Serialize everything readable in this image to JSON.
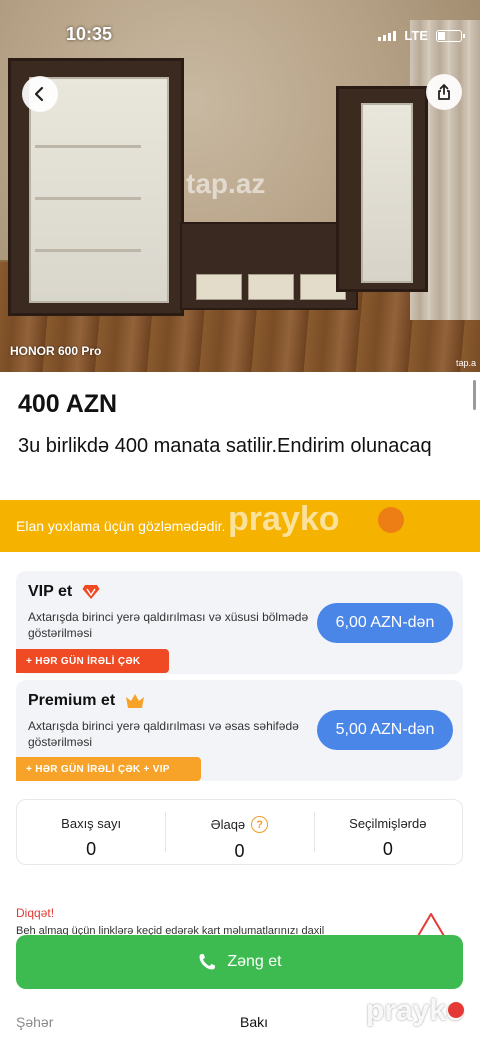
{
  "status_bar": {
    "time": "10:35",
    "network": "LTE"
  },
  "photo": {
    "watermark": "tap.az",
    "watermark_small": "tap.a",
    "device_label": "HONOR 600 Pro"
  },
  "listing": {
    "price": "400 AZN",
    "title": "3u birlikdə 400 manata satilir.Endirim olunacaq"
  },
  "banner": {
    "text": "Elan yoxlama üçün gözləmədədir."
  },
  "watermarks": {
    "prayko": "prayko"
  },
  "promotions": [
    {
      "title": "VIP et",
      "description": "Axtarışda birinci yerə qaldırılması və xüsusi bölmədə göstərilməsi",
      "price": "6,00 AZN-dən",
      "tag": "+ HƏR GÜN İRƏLİ ÇƏK",
      "icon": "diamond-icon"
    },
    {
      "title": "Premium et",
      "description": "Axtarışda birinci yerə qaldırılması və əsas səhifədə göstərilməsi",
      "price": "5,00 AZN-dən",
      "tag": "+ HƏR GÜN İRƏLİ ÇƏK + VIP",
      "icon": "crown-icon"
    }
  ],
  "stats": [
    {
      "label": "Baxış sayı",
      "value": "0"
    },
    {
      "label": "Əlaqə",
      "value": "0"
    },
    {
      "label": "Seçilmişlərdə",
      "value": "0"
    }
  ],
  "warning": {
    "title": "Diqqət!",
    "text": "Beh almaq üçün linklərə keçid edərək kart məlumatlarınızı daxil"
  },
  "call_button": {
    "label": "Zəng et"
  },
  "details": {
    "city_label": "Şəhər",
    "city_value": "Bakı"
  },
  "colors": {
    "banner": "#f5b300",
    "price_pill": "#4a86e8",
    "call_button": "#3dbb50",
    "vip_tag": "#ef4a23",
    "premium_tag": "#f7a329",
    "warning": "#e53935"
  }
}
